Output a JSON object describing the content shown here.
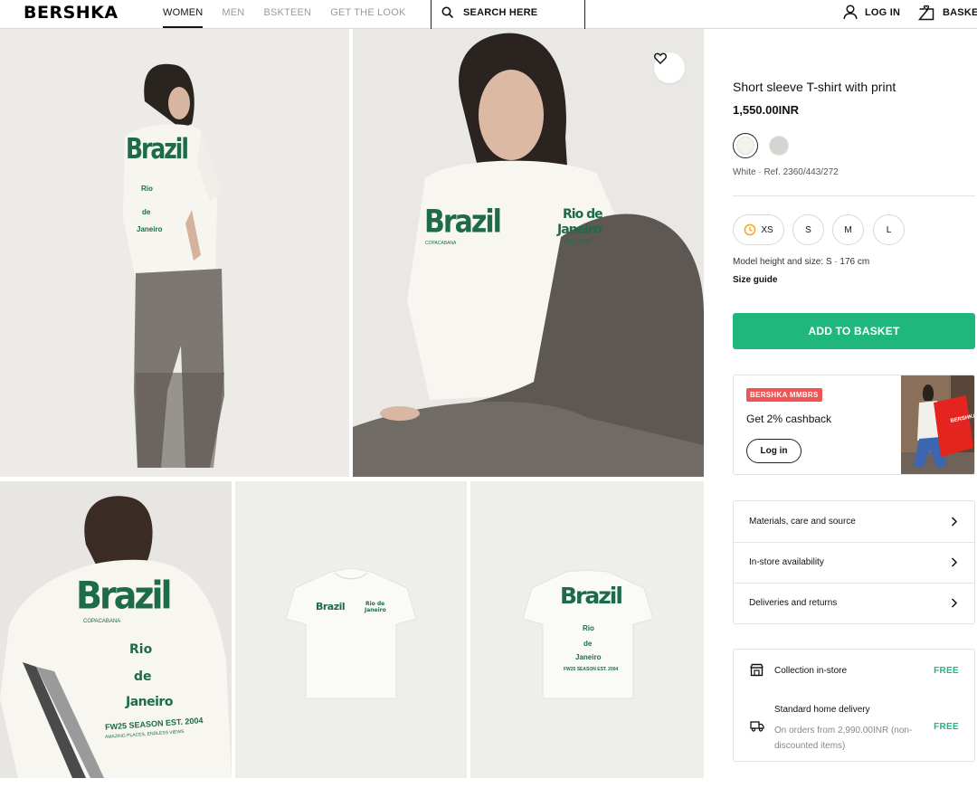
{
  "header": {
    "logo": "BERSHKA",
    "nav": [
      {
        "label": "WOMEN",
        "active": true
      },
      {
        "label": "MEN",
        "active": false
      },
      {
        "label": "BSKTEEN",
        "active": false
      },
      {
        "label": "GET THE LOOK",
        "active": false
      }
    ],
    "search_label": "SEARCH HERE",
    "login_label": "LOG IN",
    "basket_label": "BASKET"
  },
  "gallery": {
    "shirt_text": {
      "brazil": "Brazil",
      "rio": "Rio de",
      "janeiro": "Janeiro",
      "est": "EST. 2004",
      "copacabana": "COPACABANA",
      "rio_line": "Rio",
      "de_line": "de",
      "season": "FW25 SEASON EST. 2004",
      "tagline": "AMAZING PLACES, ENDLESS VIEWS"
    }
  },
  "product": {
    "title": "Short sleeve T-shirt with print",
    "price": "1,550.00INR",
    "colors": [
      {
        "name": "White",
        "hex": "#f4f2ec",
        "selected": true
      },
      {
        "name": "Grey",
        "hex": "#d3d5d1",
        "selected": false
      }
    ],
    "ref_text": "White · Ref. 2360/443/272",
    "sizes": [
      "XS",
      "S",
      "M",
      "L"
    ],
    "model_info": "Model height and size: S · 176 cm",
    "size_guide": "Size guide",
    "add_to_basket": "ADD TO BASKET"
  },
  "promo": {
    "badge": "BERSHKA MMBRS",
    "text": "Get 2% cashback",
    "login": "Log in",
    "bag_text": "BERSHKA MMBRS"
  },
  "accordion": [
    "Materials, care and source",
    "In-store availability",
    "Deliveries and returns"
  ],
  "delivery": {
    "collection": "Collection in-store",
    "collection_price": "FREE",
    "home": "Standard home delivery",
    "home_sub": "On orders from 2,990.00INR (non-discounted items)",
    "home_price": "FREE"
  },
  "colors": {
    "accent_green": "#1fb77e",
    "print_green": "#1d6b4a",
    "badge_red": "#ee5555"
  },
  "icons": [
    "search-icon",
    "user-icon",
    "basket-icon",
    "heart-icon",
    "chevron-right-icon",
    "store-icon",
    "truck-icon",
    "clock-icon"
  ]
}
